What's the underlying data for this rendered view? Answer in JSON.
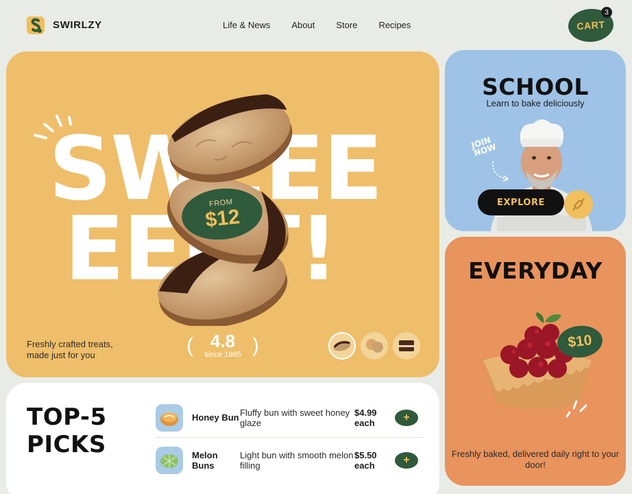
{
  "brand": {
    "name": "SWIRLZY"
  },
  "nav": {
    "items": [
      "Life & News",
      "About",
      "Store",
      "Recipes"
    ]
  },
  "cart": {
    "label": "CART",
    "count": "3"
  },
  "hero": {
    "headline_line1": "SWEEE",
    "headline_line2": "EEET!",
    "price_from": "FROM",
    "price": "$12",
    "tagline": "Freshly crafted treats, made just for you",
    "rating_value": "4.8",
    "rating_since": "since 1985",
    "thumbnails": [
      "cookie-thumb",
      "biscuit-thumb",
      "brownie-thumb"
    ]
  },
  "school": {
    "title": "SCHOOL",
    "subtitle": "Learn to bake deliciously",
    "join_line1": "JOIN",
    "join_line2": "NOW",
    "cta": "EXPLORE"
  },
  "everyday": {
    "title": "EVERYDAY",
    "price": "$10",
    "footer": "Freshly baked, delivered daily right to your door!"
  },
  "picks": {
    "title_line1": "TOP-5",
    "title_line2": "PICKS",
    "items": [
      {
        "name": "Honey Bun",
        "desc": "Fluffy bun with sweet honey glaze",
        "price": "$4.99 each"
      },
      {
        "name": "Melon Buns",
        "desc": "Light bun with smooth melon filling",
        "price": "$5.50 each"
      }
    ]
  },
  "colors": {
    "background": "#e9ece6",
    "hero": "#efbe6a",
    "school": "#9ec3e6",
    "everyday": "#e9935d",
    "accent_green": "#2f5a3c",
    "accent_yellow": "#f1bf5b"
  }
}
